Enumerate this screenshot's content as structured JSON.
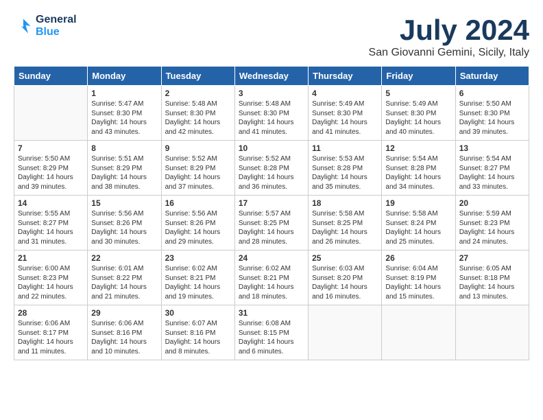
{
  "header": {
    "logo_line1": "General",
    "logo_line2": "Blue",
    "month": "July 2024",
    "location": "San Giovanni Gemini, Sicily, Italy"
  },
  "days_of_week": [
    "Sunday",
    "Monday",
    "Tuesday",
    "Wednesday",
    "Thursday",
    "Friday",
    "Saturday"
  ],
  "weeks": [
    [
      {
        "day": "",
        "empty": true
      },
      {
        "day": "1",
        "sunrise": "Sunrise: 5:47 AM",
        "sunset": "Sunset: 8:30 PM",
        "daylight": "Daylight: 14 hours and 43 minutes."
      },
      {
        "day": "2",
        "sunrise": "Sunrise: 5:48 AM",
        "sunset": "Sunset: 8:30 PM",
        "daylight": "Daylight: 14 hours and 42 minutes."
      },
      {
        "day": "3",
        "sunrise": "Sunrise: 5:48 AM",
        "sunset": "Sunset: 8:30 PM",
        "daylight": "Daylight: 14 hours and 41 minutes."
      },
      {
        "day": "4",
        "sunrise": "Sunrise: 5:49 AM",
        "sunset": "Sunset: 8:30 PM",
        "daylight": "Daylight: 14 hours and 41 minutes."
      },
      {
        "day": "5",
        "sunrise": "Sunrise: 5:49 AM",
        "sunset": "Sunset: 8:30 PM",
        "daylight": "Daylight: 14 hours and 40 minutes."
      },
      {
        "day": "6",
        "sunrise": "Sunrise: 5:50 AM",
        "sunset": "Sunset: 8:30 PM",
        "daylight": "Daylight: 14 hours and 39 minutes."
      }
    ],
    [
      {
        "day": "7",
        "sunrise": "Sunrise: 5:50 AM",
        "sunset": "Sunset: 8:29 PM",
        "daylight": "Daylight: 14 hours and 39 minutes."
      },
      {
        "day": "8",
        "sunrise": "Sunrise: 5:51 AM",
        "sunset": "Sunset: 8:29 PM",
        "daylight": "Daylight: 14 hours and 38 minutes."
      },
      {
        "day": "9",
        "sunrise": "Sunrise: 5:52 AM",
        "sunset": "Sunset: 8:29 PM",
        "daylight": "Daylight: 14 hours and 37 minutes."
      },
      {
        "day": "10",
        "sunrise": "Sunrise: 5:52 AM",
        "sunset": "Sunset: 8:28 PM",
        "daylight": "Daylight: 14 hours and 36 minutes."
      },
      {
        "day": "11",
        "sunrise": "Sunrise: 5:53 AM",
        "sunset": "Sunset: 8:28 PM",
        "daylight": "Daylight: 14 hours and 35 minutes."
      },
      {
        "day": "12",
        "sunrise": "Sunrise: 5:54 AM",
        "sunset": "Sunset: 8:28 PM",
        "daylight": "Daylight: 14 hours and 34 minutes."
      },
      {
        "day": "13",
        "sunrise": "Sunrise: 5:54 AM",
        "sunset": "Sunset: 8:27 PM",
        "daylight": "Daylight: 14 hours and 33 minutes."
      }
    ],
    [
      {
        "day": "14",
        "sunrise": "Sunrise: 5:55 AM",
        "sunset": "Sunset: 8:27 PM",
        "daylight": "Daylight: 14 hours and 31 minutes."
      },
      {
        "day": "15",
        "sunrise": "Sunrise: 5:56 AM",
        "sunset": "Sunset: 8:26 PM",
        "daylight": "Daylight: 14 hours and 30 minutes."
      },
      {
        "day": "16",
        "sunrise": "Sunrise: 5:56 AM",
        "sunset": "Sunset: 8:26 PM",
        "daylight": "Daylight: 14 hours and 29 minutes."
      },
      {
        "day": "17",
        "sunrise": "Sunrise: 5:57 AM",
        "sunset": "Sunset: 8:25 PM",
        "daylight": "Daylight: 14 hours and 28 minutes."
      },
      {
        "day": "18",
        "sunrise": "Sunrise: 5:58 AM",
        "sunset": "Sunset: 8:25 PM",
        "daylight": "Daylight: 14 hours and 26 minutes."
      },
      {
        "day": "19",
        "sunrise": "Sunrise: 5:58 AM",
        "sunset": "Sunset: 8:24 PM",
        "daylight": "Daylight: 14 hours and 25 minutes."
      },
      {
        "day": "20",
        "sunrise": "Sunrise: 5:59 AM",
        "sunset": "Sunset: 8:23 PM",
        "daylight": "Daylight: 14 hours and 24 minutes."
      }
    ],
    [
      {
        "day": "21",
        "sunrise": "Sunrise: 6:00 AM",
        "sunset": "Sunset: 8:23 PM",
        "daylight": "Daylight: 14 hours and 22 minutes."
      },
      {
        "day": "22",
        "sunrise": "Sunrise: 6:01 AM",
        "sunset": "Sunset: 8:22 PM",
        "daylight": "Daylight: 14 hours and 21 minutes."
      },
      {
        "day": "23",
        "sunrise": "Sunrise: 6:02 AM",
        "sunset": "Sunset: 8:21 PM",
        "daylight": "Daylight: 14 hours and 19 minutes."
      },
      {
        "day": "24",
        "sunrise": "Sunrise: 6:02 AM",
        "sunset": "Sunset: 8:21 PM",
        "daylight": "Daylight: 14 hours and 18 minutes."
      },
      {
        "day": "25",
        "sunrise": "Sunrise: 6:03 AM",
        "sunset": "Sunset: 8:20 PM",
        "daylight": "Daylight: 14 hours and 16 minutes."
      },
      {
        "day": "26",
        "sunrise": "Sunrise: 6:04 AM",
        "sunset": "Sunset: 8:19 PM",
        "daylight": "Daylight: 14 hours and 15 minutes."
      },
      {
        "day": "27",
        "sunrise": "Sunrise: 6:05 AM",
        "sunset": "Sunset: 8:18 PM",
        "daylight": "Daylight: 14 hours and 13 minutes."
      }
    ],
    [
      {
        "day": "28",
        "sunrise": "Sunrise: 6:06 AM",
        "sunset": "Sunset: 8:17 PM",
        "daylight": "Daylight: 14 hours and 11 minutes."
      },
      {
        "day": "29",
        "sunrise": "Sunrise: 6:06 AM",
        "sunset": "Sunset: 8:16 PM",
        "daylight": "Daylight: 14 hours and 10 minutes."
      },
      {
        "day": "30",
        "sunrise": "Sunrise: 6:07 AM",
        "sunset": "Sunset: 8:16 PM",
        "daylight": "Daylight: 14 hours and 8 minutes."
      },
      {
        "day": "31",
        "sunrise": "Sunrise: 6:08 AM",
        "sunset": "Sunset: 8:15 PM",
        "daylight": "Daylight: 14 hours and 6 minutes."
      },
      {
        "day": "",
        "empty": true
      },
      {
        "day": "",
        "empty": true
      },
      {
        "day": "",
        "empty": true
      }
    ]
  ]
}
